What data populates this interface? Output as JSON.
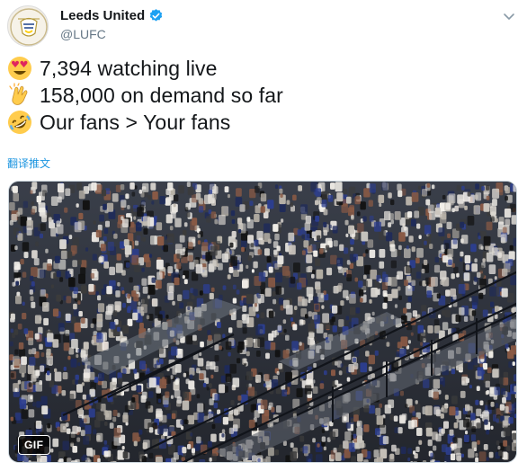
{
  "tweet": {
    "author": {
      "display_name": "Leeds United",
      "handle": "@LUFC",
      "verified": true,
      "avatar_icon": "leeds-united-crest"
    },
    "lines": [
      {
        "emoji": "heart-eyes-emoji",
        "text": "7,394 watching live"
      },
      {
        "emoji": "clapping-hands-emoji",
        "text": "158,000 on demand so far"
      },
      {
        "emoji": "rolling-laughing-emoji",
        "text": "Our fans > Your fans"
      }
    ],
    "translate_link": "翻译推文",
    "media": {
      "type": "gif",
      "badge": "GIF",
      "description_icon": "crowd-in-stadium-stands"
    }
  },
  "colors": {
    "text": "#14171a",
    "secondary": "#657786",
    "link": "#1b95e0",
    "verified": "#1da1f2"
  }
}
